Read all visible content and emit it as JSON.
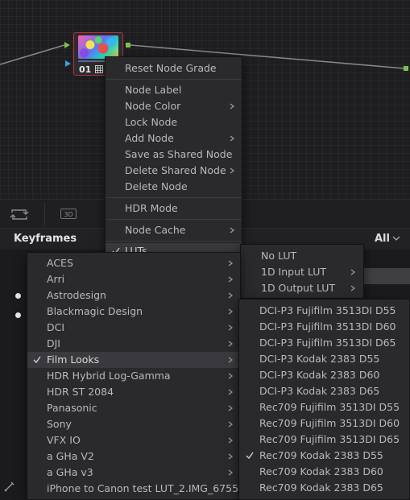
{
  "node": {
    "number": "01"
  },
  "toolbar": {
    "badge_3d": "3D"
  },
  "keyframes": {
    "title": "Keyframes",
    "filter": "All"
  },
  "context_menu": {
    "reset_node_grade": "Reset Node Grade",
    "node_label": "Node Label",
    "node_color": "Node Color",
    "lock_node": "Lock Node",
    "add_node": "Add Node",
    "save_shared_node": "Save as Shared Node",
    "delete_shared_node": "Delete Shared Node",
    "delete_node": "Delete Node",
    "hdr_mode": "HDR Mode",
    "node_cache": "Node Cache",
    "luts": "LUTs"
  },
  "lut_menu": {
    "items": [
      "No LUT",
      "1D Input LUT",
      "1D Output LUT"
    ]
  },
  "lut_categories": {
    "items": [
      "ACES",
      "Arri",
      "Astrodesign",
      "Blackmagic Design",
      "DCI",
      "DJI",
      "Film Looks",
      "HDR Hybrid Log-Gamma",
      "HDR ST 2084",
      "Panasonic",
      "Sony",
      "VFX IO",
      "a GHa V2",
      "a GHa v3",
      "iPhone to Canon test LUT_2.IMG_6755"
    ],
    "selected": "Film Looks"
  },
  "film_looks": {
    "items": [
      "DCI-P3 Fujifilm 3513DI D55",
      "DCI-P3 Fujifilm 3513DI D60",
      "DCI-P3 Fujifilm 3513DI D65",
      "DCI-P3 Kodak 2383 D55",
      "DCI-P3 Kodak 2383 D60",
      "DCI-P3 Kodak 2383 D65",
      "Rec709 Fujifilm 3513DI D55",
      "Rec709 Fujifilm 3513DI D60",
      "Rec709 Fujifilm 3513DI D65",
      "Rec709 Kodak 2383 D55",
      "Rec709 Kodak 2383 D60",
      "Rec709 Kodak 2383 D65"
    ],
    "selected": "Rec709 Kodak 2383 D55"
  },
  "colors": {
    "node_border": "#b3323a",
    "input_green": "#7cc24a",
    "input_blue": "#3aa2e0",
    "menu_bg": "#2a2a2d",
    "highlight": "#3a3a3e"
  }
}
